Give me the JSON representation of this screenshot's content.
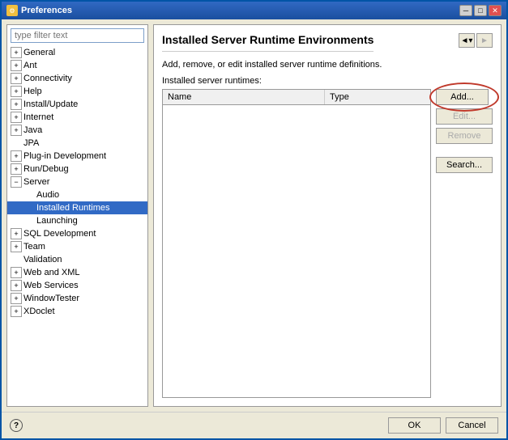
{
  "window": {
    "title": "Preferences",
    "icon": "⚙"
  },
  "titlebar": {
    "minimize": "─",
    "maximize": "□",
    "close": "✕"
  },
  "filter": {
    "placeholder": "type filter text"
  },
  "tree": {
    "items": [
      {
        "id": "general",
        "label": "General",
        "type": "collapsed",
        "depth": 0
      },
      {
        "id": "ant",
        "label": "Ant",
        "type": "collapsed",
        "depth": 0
      },
      {
        "id": "connectivity",
        "label": "Connectivity",
        "type": "collapsed",
        "depth": 0
      },
      {
        "id": "help",
        "label": "Help",
        "type": "collapsed",
        "depth": 0
      },
      {
        "id": "install-update",
        "label": "Install/Update",
        "type": "collapsed",
        "depth": 0
      },
      {
        "id": "internet",
        "label": "Internet",
        "type": "collapsed",
        "depth": 0
      },
      {
        "id": "java",
        "label": "Java",
        "type": "collapsed",
        "depth": 0
      },
      {
        "id": "jpa",
        "label": "JPA",
        "type": "leaf",
        "depth": 0
      },
      {
        "id": "plugin-dev",
        "label": "Plug-in Development",
        "type": "collapsed",
        "depth": 0
      },
      {
        "id": "run-debug",
        "label": "Run/Debug",
        "type": "collapsed",
        "depth": 0
      },
      {
        "id": "server",
        "label": "Server",
        "type": "expanded",
        "depth": 0
      },
      {
        "id": "audio",
        "label": "Audio",
        "type": "leaf",
        "depth": 1
      },
      {
        "id": "installed-runtimes",
        "label": "Installed Runtimes",
        "type": "leaf",
        "depth": 1,
        "selected": true
      },
      {
        "id": "launching",
        "label": "Launching",
        "type": "leaf",
        "depth": 1
      },
      {
        "id": "sql-dev",
        "label": "SQL Development",
        "type": "collapsed",
        "depth": 0
      },
      {
        "id": "team",
        "label": "Team",
        "type": "collapsed",
        "depth": 0
      },
      {
        "id": "validation",
        "label": "Validation",
        "type": "leaf",
        "depth": 0
      },
      {
        "id": "web-xml",
        "label": "Web and XML",
        "type": "collapsed",
        "depth": 0
      },
      {
        "id": "web-services",
        "label": "Web Services",
        "type": "collapsed",
        "depth": 0
      },
      {
        "id": "window-tester",
        "label": "WindowTester",
        "type": "collapsed",
        "depth": 0
      },
      {
        "id": "xdoclet",
        "label": "XDoclet",
        "type": "collapsed",
        "depth": 0
      }
    ]
  },
  "panel": {
    "title": "Installed Server Runtime Environments",
    "description": "Add, remove, or edit installed server runtime definitions.",
    "runtimes_label": "Installed server runtimes:",
    "table": {
      "columns": [
        "Name",
        "Type"
      ],
      "rows": []
    },
    "buttons": {
      "add": "Add...",
      "edit": "Edit...",
      "remove": "Remove",
      "search": "Search..."
    }
  },
  "bottom": {
    "ok": "OK",
    "cancel": "Cancel"
  }
}
